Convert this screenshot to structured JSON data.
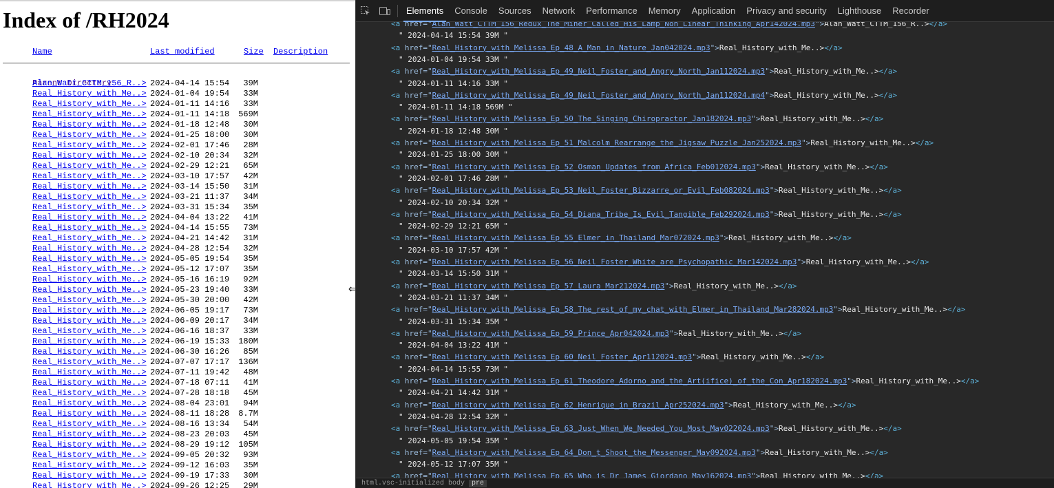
{
  "listing": {
    "title": "Index of /RH2024",
    "headers": {
      "name": "Name",
      "modified": "Last modified",
      "size": "Size",
      "description": "Description"
    },
    "parent": {
      "name": "Parent Directory",
      "size": "-"
    },
    "rows": [
      {
        "name": "Alan_Watt_CTTM_156_R..>",
        "date": "2024-04-14 15:54",
        "size": "39M"
      },
      {
        "name": "Real_History_with_Me..>",
        "date": "2024-01-04 19:54",
        "size": "33M"
      },
      {
        "name": "Real_History_with_Me..>",
        "date": "2024-01-11 14:16",
        "size": "33M"
      },
      {
        "name": "Real_History_with_Me..>",
        "date": "2024-01-11 14:18",
        "size": "569M"
      },
      {
        "name": "Real_History_with_Me..>",
        "date": "2024-01-18 12:48",
        "size": "30M"
      },
      {
        "name": "Real_History_with_Me..>",
        "date": "2024-01-25 18:00",
        "size": "30M"
      },
      {
        "name": "Real_History_with_Me..>",
        "date": "2024-02-01 17:46",
        "size": "28M"
      },
      {
        "name": "Real_History_with_Me..>",
        "date": "2024-02-10 20:34",
        "size": "32M"
      },
      {
        "name": "Real_History_with_Me..>",
        "date": "2024-02-29 12:21",
        "size": "65M"
      },
      {
        "name": "Real_History_with_Me..>",
        "date": "2024-03-10 17:57",
        "size": "42M"
      },
      {
        "name": "Real_History_with_Me..>",
        "date": "2024-03-14 15:50",
        "size": "31M"
      },
      {
        "name": "Real_History_with_Me..>",
        "date": "2024-03-21 11:37",
        "size": "34M"
      },
      {
        "name": "Real_History_with_Me..>",
        "date": "2024-03-31 15:34",
        "size": "35M"
      },
      {
        "name": "Real_History_with_Me..>",
        "date": "2024-04-04 13:22",
        "size": "41M"
      },
      {
        "name": "Real_History_with_Me..>",
        "date": "2024-04-14 15:55",
        "size": "73M"
      },
      {
        "name": "Real_History_with_Me..>",
        "date": "2024-04-21 14:42",
        "size": "31M"
      },
      {
        "name": "Real_History_with_Me..>",
        "date": "2024-04-28 12:54",
        "size": "32M"
      },
      {
        "name": "Real_History_with_Me..>",
        "date": "2024-05-05 19:54",
        "size": "35M"
      },
      {
        "name": "Real_History_with_Me..>",
        "date": "2024-05-12 17:07",
        "size": "35M"
      },
      {
        "name": "Real_History_with_Me..>",
        "date": "2024-05-16 16:19",
        "size": "92M"
      },
      {
        "name": "Real_History_with_Me..>",
        "date": "2024-05-23 19:40",
        "size": "33M"
      },
      {
        "name": "Real_History_with_Me..>",
        "date": "2024-05-30 20:00",
        "size": "42M"
      },
      {
        "name": "Real_History_with_Me..>",
        "date": "2024-06-05 19:17",
        "size": "73M"
      },
      {
        "name": "Real_History_with_Me..>",
        "date": "2024-06-09 20:17",
        "size": "34M"
      },
      {
        "name": "Real_History_with_Me..>",
        "date": "2024-06-16 18:37",
        "size": "33M"
      },
      {
        "name": "Real_History_with_Me..>",
        "date": "2024-06-19 15:33",
        "size": "180M"
      },
      {
        "name": "Real_History_with_Me..>",
        "date": "2024-06-30 16:26",
        "size": "85M"
      },
      {
        "name": "Real_History_with_Me..>",
        "date": "2024-07-07 17:17",
        "size": "136M"
      },
      {
        "name": "Real_History_with_Me..>",
        "date": "2024-07-11 19:42",
        "size": "48M"
      },
      {
        "name": "Real_History_with_Me..>",
        "date": "2024-07-18 07:11",
        "size": "41M"
      },
      {
        "name": "Real_History_with_Me..>",
        "date": "2024-07-28 18:18",
        "size": "45M"
      },
      {
        "name": "Real_History_with_Me..>",
        "date": "2024-08-04 23:01",
        "size": "94M"
      },
      {
        "name": "Real_History_with_Me..>",
        "date": "2024-08-11 18:28",
        "size": "8.7M"
      },
      {
        "name": "Real_History_with_Me..>",
        "date": "2024-08-16 13:34",
        "size": "54M"
      },
      {
        "name": "Real_History_with_Me..>",
        "date": "2024-08-23 20:03",
        "size": "45M"
      },
      {
        "name": "Real_History_with_Me..>",
        "date": "2024-08-29 19:12",
        "size": "105M"
      },
      {
        "name": "Real_History_with_Me..>",
        "date": "2024-09-05 20:32",
        "size": "93M"
      },
      {
        "name": "Real_History_with_Me..>",
        "date": "2024-09-12 16:03",
        "size": "35M"
      },
      {
        "name": "Real_History_with_Me..>",
        "date": "2024-09-19 17:33",
        "size": "30M"
      },
      {
        "name": "Real_History_with_Me..>",
        "date": "2024-09-26 12:25",
        "size": "29M"
      }
    ]
  },
  "devtools": {
    "tabs": [
      "Elements",
      "Console",
      "Sources",
      "Network",
      "Performance",
      "Memory",
      "Application",
      "Privacy and security",
      "Lighthouse",
      "Recorder"
    ],
    "active_tab": "Elements",
    "icons": [
      "inspect-icon",
      "device-toolbar-icon"
    ],
    "link_text_truncated": "Real_History_with_Me..>",
    "dom_lines": [
      {
        "type": "tag",
        "href": "Alan_Watt_CTTM_156_Redux_The_Miner_Called_His_Lamp_Non_Linear_Thinking_Apr142024.mp3",
        "text": "Alan_Watt_CTTM_156_R..>"
      },
      {
        "type": "txt",
        "text": "\" 2024-04-14 15:54 39M \""
      },
      {
        "type": "tag",
        "href": "Real_History_with_Melissa_Ep_48_A_Man_in_Nature_Jan042024.mp3",
        "text": "Real_History_with_Me..>"
      },
      {
        "type": "txt",
        "text": "\" 2024-01-04 19:54 33M \""
      },
      {
        "type": "tag",
        "href": "Real_History_with_Melissa_Ep_49_Neil_Foster_and_Angry_North_Jan112024.mp3",
        "text": "Real_History_with_Me..>"
      },
      {
        "type": "txt",
        "text": "\" 2024-01-11 14:16 33M \""
      },
      {
        "type": "tag",
        "href": "Real_History_with_Melissa_Ep_49_Neil_Foster_and_Angry_North_Jan112024.mp4",
        "text": "Real_History_with_Me..>"
      },
      {
        "type": "txt",
        "text": "\" 2024-01-11 14:18 569M \""
      },
      {
        "type": "tag",
        "href": "Real_History_with_Melissa_Ep_50_The_Singing_Chiropractor_Jan182024.mp3",
        "text": "Real_History_with_Me..>"
      },
      {
        "type": "txt",
        "text": "\" 2024-01-18 12:48 30M \""
      },
      {
        "type": "tag",
        "href": "Real_History_with_Melissa_Ep_51_Malcolm_Rearrange_the_Jigsaw_Puzzle_Jan252024.mp3",
        "text": "Real_History_with_Me..>"
      },
      {
        "type": "txt",
        "text": "\" 2024-01-25 18:00 30M \""
      },
      {
        "type": "tag",
        "href": "Real_History_with_Melissa_Ep_52_Osman_Updates_from_Africa_Feb012024.mp3",
        "text": "Real_History_with_Me..>"
      },
      {
        "type": "txt",
        "text": "\" 2024-02-01 17:46 28M \""
      },
      {
        "type": "tag",
        "href": "Real_History_with_Melissa_Ep_53_Neil_Foster_Bizzarre_or_Evil_Feb082024.mp3",
        "text": "Real_History_with_Me..>"
      },
      {
        "type": "txt",
        "text": "\" 2024-02-10 20:34 32M \""
      },
      {
        "type": "tag",
        "href": "Real_History_with_Melissa_Ep_54_Diana_Tribe_Is_Evil_Tangible_Feb292024.mp3",
        "text": "Real_History_with_Me..>"
      },
      {
        "type": "txt",
        "text": "\" 2024-02-29 12:21 65M \""
      },
      {
        "type": "tag",
        "href": "Real_History_with_Melissa_Ep_55_Elmer_in_Thailand_Mar072024.mp3",
        "text": "Real_History_with_Me..>"
      },
      {
        "type": "txt",
        "text": "\" 2024-03-10 17:57 42M \""
      },
      {
        "type": "tag",
        "href": "Real_History_with_Melissa_Ep_56_Neil_Foster_White_are_Psychopathic_Mar142024.mp3",
        "text": "Real_History_with_Me..>"
      },
      {
        "type": "txt",
        "text": "\" 2024-03-14 15:50 31M \""
      },
      {
        "type": "tag",
        "href": "Real_History_with_Melissa_Ep_57_Laura_Mar212024.mp3",
        "text": "Real_History_with_Me..>"
      },
      {
        "type": "txt",
        "text": "\" 2024-03-21 11:37 34M \""
      },
      {
        "type": "tag",
        "href": "Real_History_with_Melissa_Ep_58_The_rest_of_my_chat_with_Elmer_in_Thailand_Mar282024.mp3",
        "text": "Real_History_with_Me..>"
      },
      {
        "type": "txt",
        "text": "\" 2024-03-31 15:34 35M \""
      },
      {
        "type": "tag",
        "href": "Real_History_with_Melissa_Ep_59_Prince_Apr042024.mp3",
        "text": "Real_History_with_Me..>"
      },
      {
        "type": "txt",
        "text": "\" 2024-04-04 13:22 41M \""
      },
      {
        "type": "tag",
        "href": "Real_History_with_Melissa_Ep_60_Neil_Foster_Apr112024.mp3",
        "text": "Real_History_with_Me..>"
      },
      {
        "type": "txt",
        "text": "\" 2024-04-14 15:55 73M \""
      },
      {
        "type": "tag",
        "href": "Real_History_with_Melissa_Ep_61_Theodore_Adorno_and_the_Art(ifice)_of_the_Con_Apr182024.mp3",
        "text": "Real_History_with_Me..>"
      },
      {
        "type": "txt",
        "text": "\" 2024-04-21 14:42 31M \""
      },
      {
        "type": "tag",
        "href": "Real_History_with_Melissa_Ep_62_Henrique_in_Brazil_Apr252024.mp3",
        "text": "Real_History_with_Me..>"
      },
      {
        "type": "txt",
        "text": "\" 2024-04-28 12:54 32M \""
      },
      {
        "type": "tag",
        "href": "Real_History_with_Melissa_Ep_63_Just_When_We_Needed_You_Most_May022024.mp3",
        "text": "Real_History_with_Me..>"
      },
      {
        "type": "txt",
        "text": "\" 2024-05-05 19:54 35M \""
      },
      {
        "type": "tag",
        "href": "Real_History_with_Melissa_Ep_64_Don_t_Shoot_the_Messenger_May092024.mp3",
        "text": "Real_History_with_Me..>"
      },
      {
        "type": "txt",
        "text": "\" 2024-05-12 17:07 35M \""
      },
      {
        "type": "tag",
        "href": "Real_History_with_Melissa_Ep_65_Who_is_Dr_James_Giordano_May162024.mp3",
        "text": "Real_History_with_Me..>"
      }
    ],
    "breadcrumb": {
      "path": "html.vsc-initialized  body",
      "selected": "pre"
    }
  }
}
